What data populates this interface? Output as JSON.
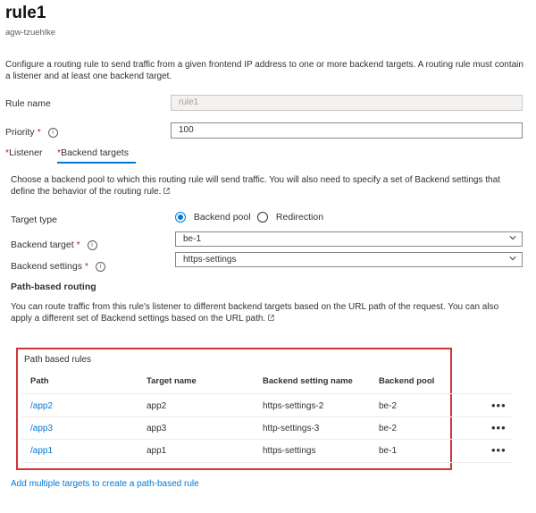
{
  "header": {
    "title": "rule1",
    "subtitle": "agw-tzuehlke"
  },
  "intro": "Configure a routing rule to send traffic from a given frontend IP address to one or more backend targets. A routing rule must contain a listener and at least one backend target.",
  "fields": {
    "rule_name": {
      "label": "Rule name",
      "value": "rule1"
    },
    "priority": {
      "label": "Priority",
      "required_mark": "*",
      "info": "i",
      "value": "100"
    }
  },
  "tabs": [
    {
      "label": "Listener",
      "required_mark": "*",
      "active": false
    },
    {
      "label": "Backend targets",
      "required_mark": "*",
      "active": true
    }
  ],
  "backend": {
    "description": "Choose a backend pool to which this routing rule will send traffic. You will also need to specify a set of Backend settings that define the behavior of the routing rule.",
    "target_type": {
      "label": "Target type",
      "options": [
        "Backend pool",
        "Redirection"
      ],
      "selected": "Backend pool"
    },
    "backend_target": {
      "label": "Backend target",
      "required_mark": "*",
      "info": "i",
      "value": "be-1"
    },
    "backend_settings": {
      "label": "Backend settings",
      "required_mark": "*",
      "info": "i",
      "value": "https-settings"
    }
  },
  "path_routing": {
    "heading": "Path-based routing",
    "description": "You can route traffic from this rule's listener to different backend targets based on the URL path of the request. You can also apply a different set of Backend settings based on the URL path.",
    "box_title": "Path based rules",
    "columns": [
      "Path",
      "Target name",
      "Backend setting name",
      "Backend pool"
    ],
    "rows": [
      {
        "path": "/app2",
        "target": "app2",
        "setting": "https-settings-2",
        "pool": "be-2",
        "more": "•••"
      },
      {
        "path": "/app3",
        "target": "app3",
        "setting": "http-settings-3",
        "pool": "be-2",
        "more": "•••"
      },
      {
        "path": "/app1",
        "target": "app1",
        "setting": "https-settings",
        "pool": "be-1",
        "more": "•••"
      }
    ],
    "add_link": "Add multiple targets to create a path-based rule"
  },
  "colors": {
    "accent": "#0078d4",
    "required": "#a4262c",
    "highlight_border": "#d13438"
  }
}
